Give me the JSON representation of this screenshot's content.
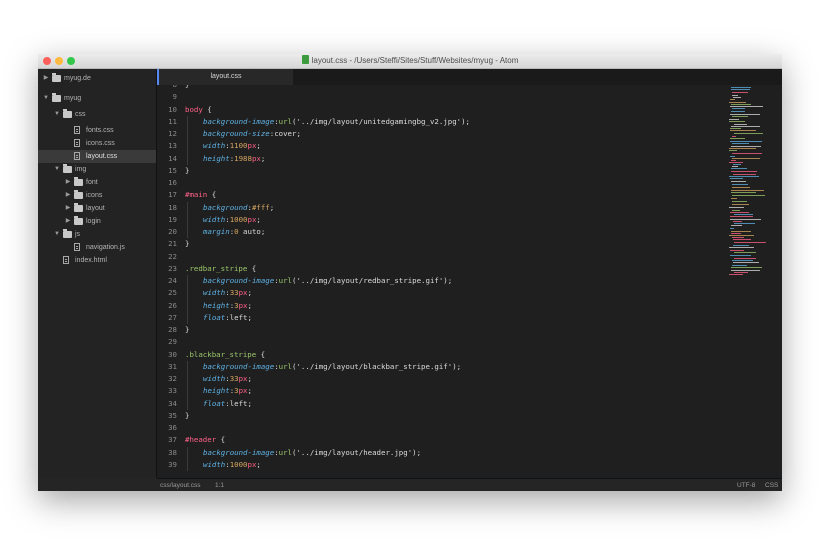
{
  "window": {
    "title": "layout.css - /Users/Steffi/Sites/Stuff/Websites/myug - Atom"
  },
  "colors": {
    "tab_accent": "#568af2",
    "selector": "#ff6188",
    "property": "#5fb3e6",
    "unit": "#ff6188",
    "number": "#d6a55f",
    "func": "#9cc76b",
    "punct": "#dcdcdc",
    "text": "#dcdcdc"
  },
  "sidebar": {
    "items": [
      {
        "label": "myug.de",
        "kind": "folder",
        "expanded": false,
        "depth": 0
      },
      {
        "label": "myug",
        "kind": "folder",
        "expanded": true,
        "depth": 0
      },
      {
        "label": "css",
        "kind": "folder",
        "expanded": true,
        "depth": 1
      },
      {
        "label": "fonts.css",
        "kind": "file",
        "depth": 2
      },
      {
        "label": "icons.css",
        "kind": "file",
        "depth": 2
      },
      {
        "label": "layout.css",
        "kind": "file",
        "depth": 2,
        "selected": true
      },
      {
        "label": "img",
        "kind": "folder",
        "expanded": true,
        "depth": 1
      },
      {
        "label": "font",
        "kind": "folder",
        "expanded": false,
        "depth": 2
      },
      {
        "label": "icons",
        "kind": "folder",
        "expanded": false,
        "depth": 2
      },
      {
        "label": "layout",
        "kind": "folder",
        "expanded": false,
        "depth": 2
      },
      {
        "label": "login",
        "kind": "folder",
        "expanded": false,
        "depth": 2
      },
      {
        "label": "js",
        "kind": "folder",
        "expanded": true,
        "depth": 1
      },
      {
        "label": "navigation.js",
        "kind": "file",
        "depth": 2
      },
      {
        "label": "index.html",
        "kind": "file",
        "depth": 1
      }
    ]
  },
  "tabs": [
    {
      "label": "layout.css",
      "active": true
    }
  ],
  "editor": {
    "lines": [
      {
        "n": "8",
        "tokens": [
          [
            "}",
            "punct"
          ]
        ]
      },
      {
        "n": "9",
        "tokens": []
      },
      {
        "n": "10",
        "tokens": [
          [
            "body",
            "selector"
          ],
          [
            " {",
            "punct"
          ]
        ]
      },
      {
        "n": "11",
        "indent": true,
        "tokens": [
          [
            "background-image",
            "property"
          ],
          [
            ":",
            "punct"
          ],
          [
            "url",
            "func"
          ],
          [
            "('../img/layout/unitedgamingbg_v2.jpg');",
            "text"
          ]
        ]
      },
      {
        "n": "12",
        "indent": true,
        "tokens": [
          [
            "background-size",
            "property"
          ],
          [
            ":cover;",
            "text"
          ]
        ]
      },
      {
        "n": "13",
        "indent": true,
        "tokens": [
          [
            "width",
            "property"
          ],
          [
            ":",
            "punct"
          ],
          [
            "1100",
            "number"
          ],
          [
            "px",
            "unit"
          ],
          [
            ";",
            "punct"
          ]
        ]
      },
      {
        "n": "14",
        "indent": true,
        "tokens": [
          [
            "height",
            "property"
          ],
          [
            ":",
            "punct"
          ],
          [
            "1988",
            "number"
          ],
          [
            "px",
            "unit"
          ],
          [
            ";",
            "punct"
          ]
        ]
      },
      {
        "n": "15",
        "tokens": [
          [
            "}",
            "punct"
          ]
        ]
      },
      {
        "n": "16",
        "tokens": []
      },
      {
        "n": "17",
        "tokens": [
          [
            "#main",
            "selector"
          ],
          [
            " {",
            "punct"
          ]
        ]
      },
      {
        "n": "18",
        "indent": true,
        "tokens": [
          [
            "background",
            "property"
          ],
          [
            ":",
            "punct"
          ],
          [
            "#fff",
            "number"
          ],
          [
            ";",
            "punct"
          ]
        ]
      },
      {
        "n": "19",
        "indent": true,
        "tokens": [
          [
            "width",
            "property"
          ],
          [
            ":",
            "punct"
          ],
          [
            "1000",
            "number"
          ],
          [
            "px",
            "unit"
          ],
          [
            ";",
            "punct"
          ]
        ]
      },
      {
        "n": "20",
        "indent": true,
        "tokens": [
          [
            "margin",
            "property"
          ],
          [
            ":",
            "punct"
          ],
          [
            "0",
            "number"
          ],
          [
            " auto;",
            "text"
          ]
        ]
      },
      {
        "n": "21",
        "tokens": [
          [
            "}",
            "punct"
          ]
        ]
      },
      {
        "n": "22",
        "tokens": []
      },
      {
        "n": "23",
        "tokens": [
          [
            ".redbar_stripe",
            "func"
          ],
          [
            " {",
            "punct"
          ]
        ]
      },
      {
        "n": "24",
        "indent": true,
        "tokens": [
          [
            "background-image",
            "property"
          ],
          [
            ":",
            "punct"
          ],
          [
            "url",
            "func"
          ],
          [
            "('../img/layout/redbar_stripe.gif');",
            "text"
          ]
        ]
      },
      {
        "n": "25",
        "indent": true,
        "tokens": [
          [
            "width",
            "property"
          ],
          [
            ":",
            "punct"
          ],
          [
            "33",
            "number"
          ],
          [
            "px",
            "unit"
          ],
          [
            ";",
            "punct"
          ]
        ]
      },
      {
        "n": "26",
        "indent": true,
        "tokens": [
          [
            "height",
            "property"
          ],
          [
            ":",
            "punct"
          ],
          [
            "3",
            "number"
          ],
          [
            "px",
            "unit"
          ],
          [
            ";",
            "punct"
          ]
        ]
      },
      {
        "n": "27",
        "indent": true,
        "tokens": [
          [
            "float",
            "property"
          ],
          [
            ":left;",
            "text"
          ]
        ]
      },
      {
        "n": "28",
        "tokens": [
          [
            "}",
            "punct"
          ]
        ]
      },
      {
        "n": "29",
        "tokens": []
      },
      {
        "n": "30",
        "tokens": [
          [
            ".blackbar_stripe",
            "func"
          ],
          [
            " {",
            "punct"
          ]
        ]
      },
      {
        "n": "31",
        "indent": true,
        "tokens": [
          [
            "background-image",
            "property"
          ],
          [
            ":",
            "punct"
          ],
          [
            "url",
            "func"
          ],
          [
            "('../img/layout/blackbar_stripe.gif');",
            "text"
          ]
        ]
      },
      {
        "n": "32",
        "indent": true,
        "tokens": [
          [
            "width",
            "property"
          ],
          [
            ":",
            "punct"
          ],
          [
            "33",
            "number"
          ],
          [
            "px",
            "unit"
          ],
          [
            ";",
            "punct"
          ]
        ]
      },
      {
        "n": "33",
        "indent": true,
        "tokens": [
          [
            "height",
            "property"
          ],
          [
            ":",
            "punct"
          ],
          [
            "3",
            "number"
          ],
          [
            "px",
            "unit"
          ],
          [
            ";",
            "punct"
          ]
        ]
      },
      {
        "n": "34",
        "indent": true,
        "tokens": [
          [
            "float",
            "property"
          ],
          [
            ":left;",
            "text"
          ]
        ]
      },
      {
        "n": "35",
        "tokens": [
          [
            "}",
            "punct"
          ]
        ]
      },
      {
        "n": "36",
        "tokens": []
      },
      {
        "n": "37",
        "tokens": [
          [
            "#header",
            "selector"
          ],
          [
            " {",
            "punct"
          ]
        ]
      },
      {
        "n": "38",
        "indent": true,
        "tokens": [
          [
            "background-image",
            "property"
          ],
          [
            ":",
            "punct"
          ],
          [
            "url",
            "func"
          ],
          [
            "('../img/layout/header.jpg');",
            "text"
          ]
        ]
      },
      {
        "n": "39",
        "indent": true,
        "tokens": [
          [
            "width",
            "property"
          ],
          [
            ":",
            "punct"
          ],
          [
            "1000",
            "number"
          ],
          [
            "px",
            "unit"
          ],
          [
            ";",
            "punct"
          ]
        ]
      }
    ]
  },
  "statusbar": {
    "file_path": "css/layout.css",
    "cursor": "1:1",
    "encoding": "UTF-8",
    "grammar": "CSS"
  }
}
